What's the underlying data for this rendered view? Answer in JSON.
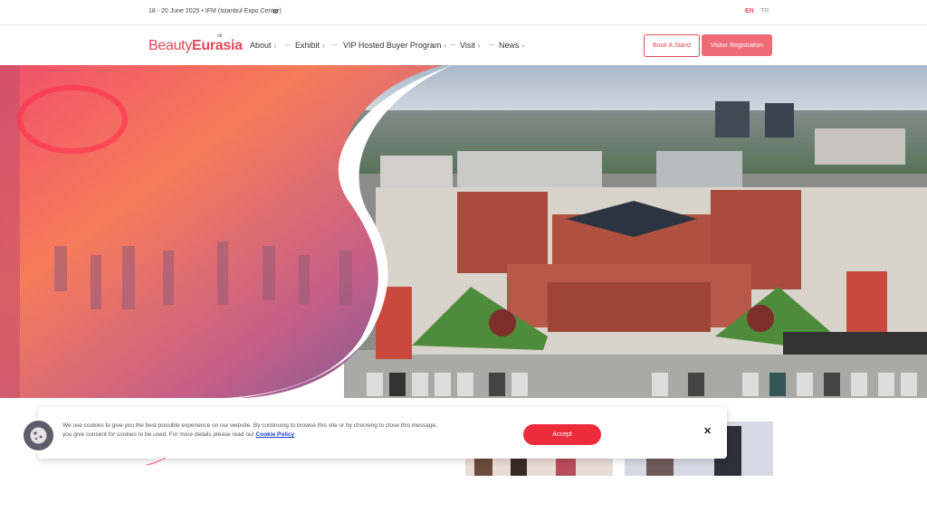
{
  "topbar": {
    "event_info": "18 - 20 June 2025 • IFM (Istanbul Expo Center)",
    "location_icon": "map-pin-icon",
    "languages": [
      {
        "code": "EN",
        "active": true
      },
      {
        "code": "TR",
        "active": false
      }
    ]
  },
  "header": {
    "logo_part1": "Beauty",
    "logo_part2": "Eurasia",
    "logo_badge": "ufi",
    "menu": [
      {
        "label": "About",
        "chevron": "›"
      },
      {
        "label": "Exhibit",
        "chevron": "›"
      },
      {
        "label": "VIP Hosted Buyer Program",
        "chevron": "›"
      },
      {
        "label": "Visit",
        "chevron": "›"
      },
      {
        "label": "News",
        "chevron": "›"
      }
    ],
    "book_stand_label": "Book A Stand",
    "visitor_registration_label": "Visitor Registration"
  },
  "hero": {
    "prev_icon": "‹",
    "next_icon": "›",
    "slides_count": 3,
    "active_slide": 1
  },
  "cookie_banner": {
    "text_line1": "We use cookies to give you the best possible experience on our website. By continuing to browse this site or by choosing to close this message,",
    "text_line2": "you give consent for cookies to be used. For more details please read our",
    "policy_link": "Cookie Policy",
    "accept_label": "Accept",
    "close_label": "✕"
  },
  "colors": {
    "brand": "#e4475b",
    "accent_button": "#ef6b76",
    "accept_button": "#ee2b3b",
    "link": "#1a3cd6"
  }
}
